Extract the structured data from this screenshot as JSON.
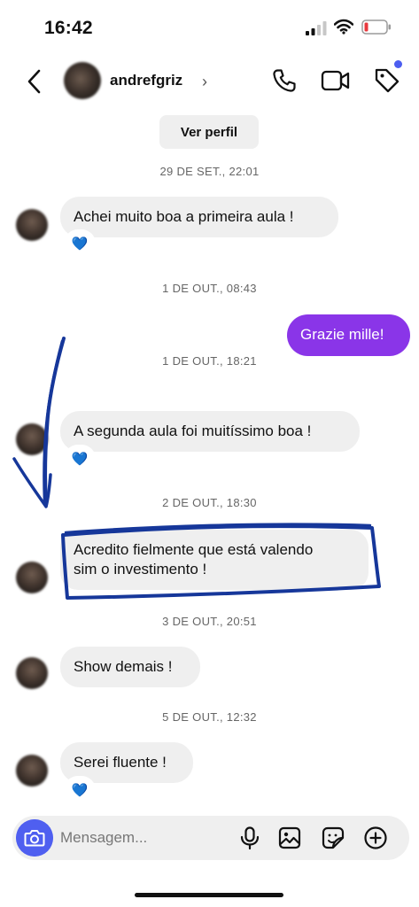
{
  "status": {
    "time": "16:42"
  },
  "header": {
    "username": "andrefgriz",
    "chevron": "›"
  },
  "profile_button": "Ver perfil",
  "messages": [
    {
      "timestamp": "29 DE SET., 22:01",
      "text": "Achei muito boa a primeira aula !",
      "reaction": "💙"
    },
    {
      "timestamp": "1 DE OUT., 08:43",
      "text": "Grazie mille!"
    },
    {
      "timestamp": "1 DE OUT., 18:21",
      "text": "A segunda aula foi muitíssimo boa !",
      "reaction": "💙"
    },
    {
      "timestamp": "2 DE OUT., 18:30",
      "text_line1": "Acredito fielmente que está valendo",
      "text_line2": "sim o investimento !"
    },
    {
      "timestamp": "3 DE OUT., 20:51",
      "text": "Show demais !"
    },
    {
      "timestamp": "5 DE OUT., 12:32",
      "text": "Serei fluente !",
      "reaction": "💙"
    }
  ],
  "composer": {
    "placeholder": "Mensagem..."
  },
  "colors": {
    "outgoing_bubble": "#8a35e8",
    "accent_blue": "#4f5ff0",
    "annotation_ink": "#16379a"
  },
  "icons": [
    "back-chevron-icon",
    "phone-icon",
    "video-camera-icon",
    "tag-icon",
    "camera-icon",
    "microphone-icon",
    "image-icon",
    "sticker-icon",
    "plus-circle-icon"
  ]
}
